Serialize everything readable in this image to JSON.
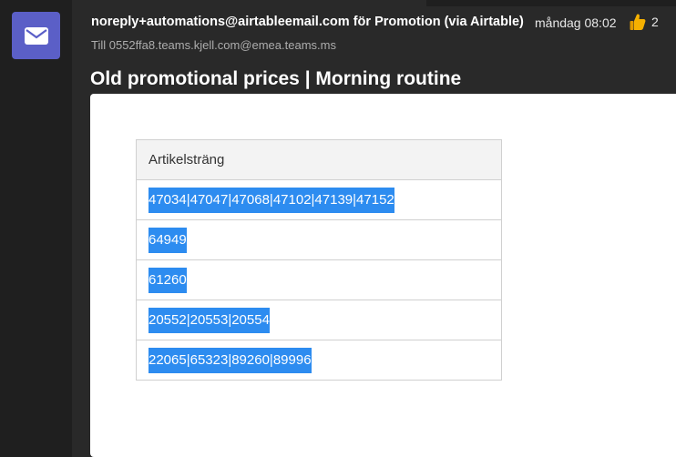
{
  "message": {
    "sender": "noreply+automations@airtableemail.com för Promotion (via Airtable)",
    "time": "måndag 08:02",
    "reaction_count": "2",
    "to_line": "Till 0552ffa8.teams.kjell.com@emea.teams.ms",
    "subject": "Old promotional prices | Morning routine"
  },
  "table": {
    "header": "Artikelsträng",
    "rows": [
      "47034|47047|47068|47102|47139|47152",
      "64949",
      "61260",
      "20552|20553|20554",
      "22065|65323|89260|89996"
    ]
  },
  "icons": {
    "avatar": "mail-icon",
    "reaction": "thumbs-up-icon"
  },
  "colors": {
    "avatar_bg": "#5b5fc7",
    "selection": "#2d8cf0",
    "background": "#292929"
  }
}
